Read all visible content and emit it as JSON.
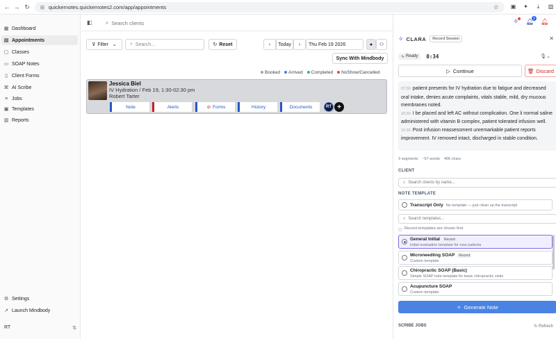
{
  "browser": {
    "url": "quickernotes.quickernotes2.com/app/appointments"
  },
  "sidebar": {
    "items": [
      {
        "label": "Dashboard",
        "icon": "dashboard-icon",
        "active": false
      },
      {
        "label": "Appointments",
        "icon": "calendar-icon",
        "active": true
      },
      {
        "label": "Classes",
        "icon": "classes-icon",
        "active": false
      },
      {
        "label": "SOAP Notes",
        "icon": "notes-icon",
        "active": false
      },
      {
        "label": "Client Forms",
        "icon": "forms-icon",
        "active": false
      },
      {
        "label": "AI Scribe",
        "icon": "scribe-icon",
        "active": false
      },
      {
        "label": "Jobs",
        "icon": "jobs-icon",
        "active": false
      },
      {
        "label": "Templates",
        "icon": "templates-icon",
        "active": false
      },
      {
        "label": "Reports",
        "icon": "reports-icon",
        "active": false
      }
    ],
    "settings_label": "Settings",
    "launch_label": "Launch Mindbody",
    "user_initials": "RT"
  },
  "topbar": {
    "search_placeholder": "Search clients",
    "notification_count": "3"
  },
  "toolbar": {
    "filter_label": "Filter",
    "search_placeholder": "Search...",
    "reset_label": "Reset",
    "today_label": "Today",
    "date": "Thu Feb 19 2026",
    "sync_label": "Sync With Mindbody"
  },
  "legend": [
    {
      "label": "Booked",
      "color": "#9ca3af"
    },
    {
      "label": "Arrived",
      "color": "#3b82f6"
    },
    {
      "label": "Completed",
      "color": "#22c55e"
    },
    {
      "label": "NoShow/Cancelled",
      "color": "#ef4444"
    }
  ],
  "appointment": {
    "client_name": "Jessica Biel",
    "detail": "IV Hydration / Feb 19, 1:30-02:30 pm",
    "staff": "Robert Tarter",
    "tabs": [
      "Note",
      "Alerts",
      "Forms",
      "History",
      "Documents"
    ],
    "staff_initials": "RT",
    "add_label": "+"
  },
  "clara": {
    "title": "CLARA",
    "badge": "Record Session",
    "status": "Ready",
    "timer": "0:34",
    "continue_label": "Continue",
    "discard_label": "Discard",
    "transcript": [
      {
        "time": "07:30",
        "text": "patient presents for IV hydration due to fatigue and decreased oral intake, denies acute complaints, vitals stable, mild, dry mucous membranes noted."
      },
      {
        "time": "10:30",
        "text": "I be placed and left AC without complication. One li normal saline administered with vitamin B complex, patient tolerated infusion well."
      },
      {
        "time": "10:30",
        "text": "Post infusion reassessment unremarkable patient reports improvement. IV removed intact, discharged in stable condition."
      }
    ],
    "stats": [
      "3 segments",
      "~57 words",
      "406 chars"
    ],
    "client_label": "CLIENT",
    "client_placeholder": "Search clients by name...",
    "template_label": "NOTE TEMPLATE",
    "transcript_only_title": "Transcript Only",
    "transcript_only_sub": "No template — just clean up the transcript",
    "template_search_placeholder": "Search templates...",
    "recent_note": "Recent templates are shown first",
    "templates": [
      {
        "title": "General Initial",
        "tag": "Recent",
        "sub": "Initial evaluation template for new patients",
        "selected": true
      },
      {
        "title": "Microneedling SOAP",
        "tag": "Recent",
        "sub": "Custom template",
        "selected": false
      },
      {
        "title": "Chiropractic SOAP (Basic)",
        "tag": "",
        "sub": "Simple SOAP note template for basic chiropractic visits",
        "selected": false
      },
      {
        "title": "Acupuncture SOAP",
        "tag": "",
        "sub": "Custom template",
        "selected": false
      }
    ],
    "generate_label": "Generate Note",
    "jobs_label": "SCRIBE JOBS",
    "refresh_label": "Refresh"
  }
}
